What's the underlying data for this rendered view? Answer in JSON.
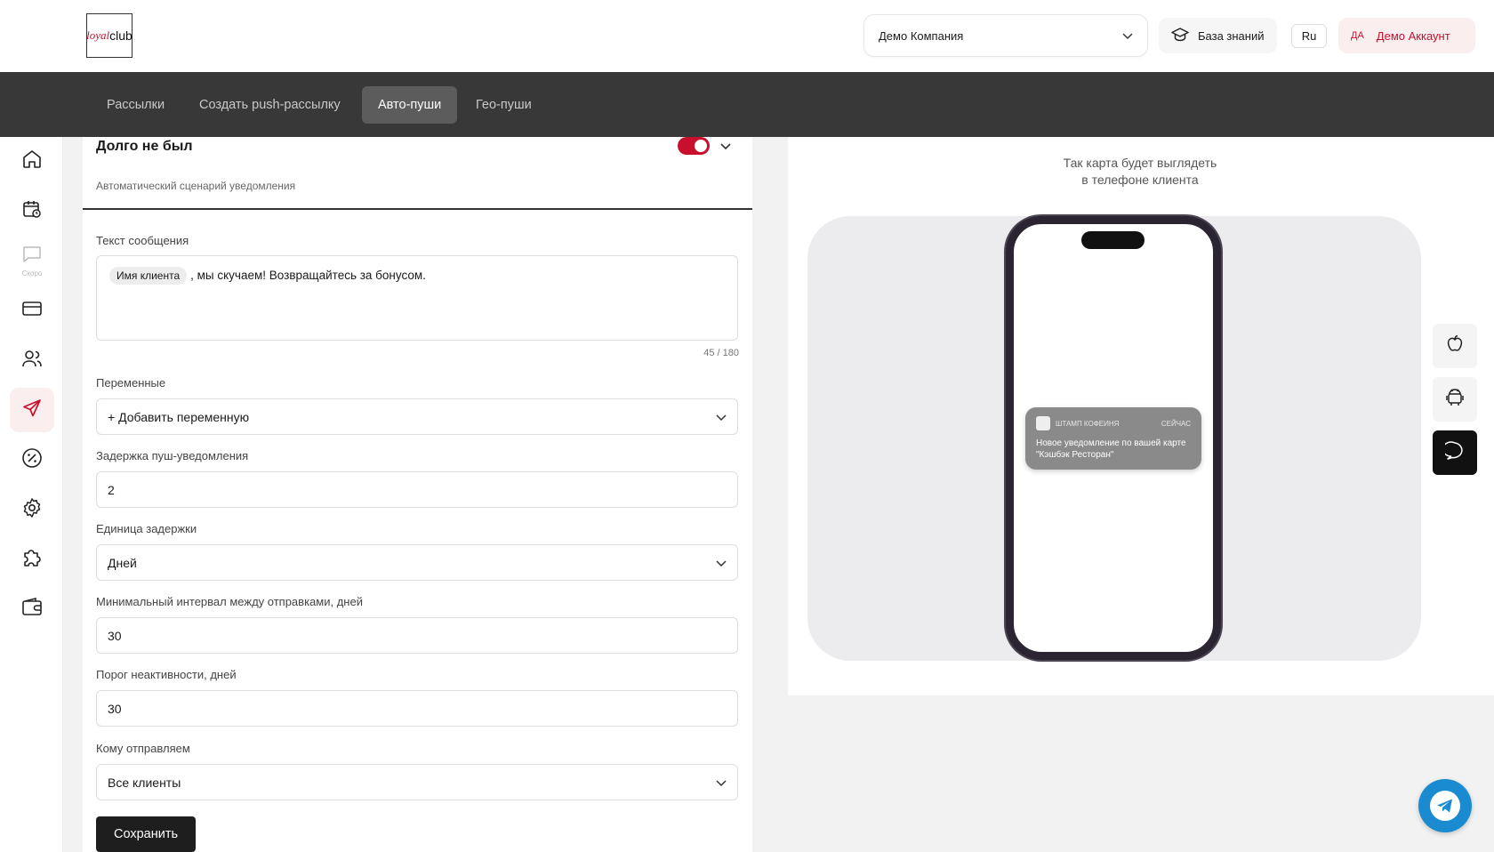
{
  "header": {
    "logo_part1": "loyal",
    "logo_part2": "club",
    "company_select": "Демо Компания",
    "knowledge_base": "База знаний",
    "language": "Ru",
    "account_initials": "ДА",
    "account_name": "Демо Аккаунт"
  },
  "tabs": [
    {
      "label": "Рассылки"
    },
    {
      "label": "Создать push-рассылку"
    },
    {
      "label": "Авто-пуши",
      "active": true
    },
    {
      "label": "Гео-пуши"
    }
  ],
  "sidebar": {
    "soon_label": "Скоро",
    "items": [
      {
        "icon": "home-icon"
      },
      {
        "icon": "calendar-icon"
      },
      {
        "icon": "chat-icon"
      },
      {
        "icon": "card-icon"
      },
      {
        "icon": "users-icon"
      },
      {
        "icon": "send-icon",
        "active": true
      },
      {
        "icon": "discount-icon"
      },
      {
        "icon": "settings-icon"
      },
      {
        "icon": "puzzle-icon"
      },
      {
        "icon": "wallet-icon"
      }
    ]
  },
  "form": {
    "title": "Долго не был",
    "subtitle": "Автоматический сценарий уведомления",
    "enabled": true,
    "message_label": "Текст сообщения",
    "message_chip": "Имя клиента",
    "message_text": ", мы скучаем! Возвращайтесь за бонусом.",
    "counter": "45 / 180",
    "variables_label": "Переменные",
    "variables_value": "+ Добавить переменную",
    "delay_label": "Задержка пуш-уведомления",
    "delay_value": "2",
    "delay_unit_label": "Единица задержки",
    "delay_unit_value": "Дней",
    "min_interval_label": "Минимальный интервал между отправками, дней",
    "min_interval_value": "30",
    "inactivity_label": "Порог неактивности, дней",
    "inactivity_value": "30",
    "recipients_label": "Кому отправляем",
    "recipients_value": "Все клиенты",
    "save_label": "Сохранить"
  },
  "preview": {
    "title_line1": "Так карта будет выглядеть",
    "title_line2": "в телефоне клиента",
    "notification": {
      "app": "ШТАМП КОФЕИНЯ",
      "time": "СЕЙЧАС",
      "text": "Новое уведомление по вашей карте \"Кэшбэк Ресторан\""
    }
  },
  "device_buttons": [
    {
      "icon": "apple-icon"
    },
    {
      "icon": "android-icon"
    },
    {
      "icon": "message-icon",
      "active": true
    }
  ],
  "colors": {
    "accent": "#c8102e",
    "navbar": "#383838",
    "dark_button": "#1e1e1e",
    "telegram": "#1a8bd0"
  }
}
